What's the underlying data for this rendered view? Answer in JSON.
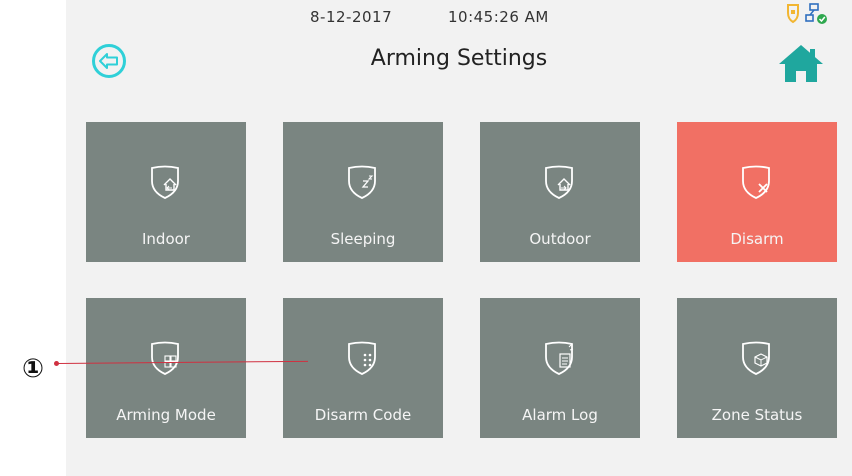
{
  "status": {
    "date": "8-12-2017",
    "time": "10:45:26 AM"
  },
  "header": {
    "title": "Arming Settings"
  },
  "tiles": [
    {
      "label": "Indoor",
      "icon": "shield-indoor-icon",
      "active": false
    },
    {
      "label": "Sleeping",
      "icon": "shield-sleeping-icon",
      "active": false
    },
    {
      "label": "Outdoor",
      "icon": "shield-outdoor-icon",
      "active": false
    },
    {
      "label": "Disarm",
      "icon": "shield-disarm-icon",
      "active": true
    },
    {
      "label": "Arming Mode",
      "icon": "shield-arming-mode-icon",
      "active": false
    },
    {
      "label": "Disarm Code",
      "icon": "shield-disarm-code-icon",
      "active": false
    },
    {
      "label": "Alarm Log",
      "icon": "shield-alarm-log-icon",
      "active": false
    },
    {
      "label": "Zone Status",
      "icon": "shield-zone-status-icon",
      "active": false
    }
  ],
  "annotation": {
    "marker": "①"
  },
  "colors": {
    "tile": "#7a8581",
    "tile_active": "#f17064",
    "accent_cyan": "#2fd0d8",
    "home_teal": "#1fa79e",
    "annotation_line": "#d03040"
  }
}
